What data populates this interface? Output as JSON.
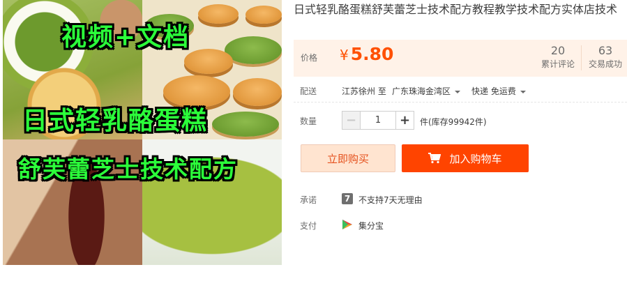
{
  "product": {
    "image_texts": [
      "视频+文档",
      "日式轻乳酪蛋糕",
      "舒芙蕾芝士技术配方"
    ],
    "title": "日式轻乳酪蛋糕舒芙蕾芝士技术配方教程教学技术配方实体店技术"
  },
  "price": {
    "label": "价格",
    "currency": "¥",
    "amount": "5.80",
    "reviews": {
      "count": "20",
      "label": "累计评论"
    },
    "trades": {
      "count": "63",
      "label": "交易成功"
    }
  },
  "shipping": {
    "label": "配送",
    "from": "江苏徐州 至",
    "to": "广东珠海金湾区",
    "method": "快递 免运费"
  },
  "quantity": {
    "label": "数量",
    "minus": "−",
    "plus": "+",
    "value": "1",
    "stock": "件(库存99942件)"
  },
  "actions": {
    "buy_now": "立即购买",
    "add_to_cart": "加入购物车"
  },
  "promise": {
    "label": "承诺",
    "icon_text": "7",
    "text": "不支持7天无理由"
  },
  "payment": {
    "label": "支付",
    "method": "集分宝"
  },
  "colors": {
    "accent": "#ff4400",
    "price": "#ff5000",
    "price_bg": "#fff2e8",
    "buy_now_bg": "#ffe4d0"
  }
}
